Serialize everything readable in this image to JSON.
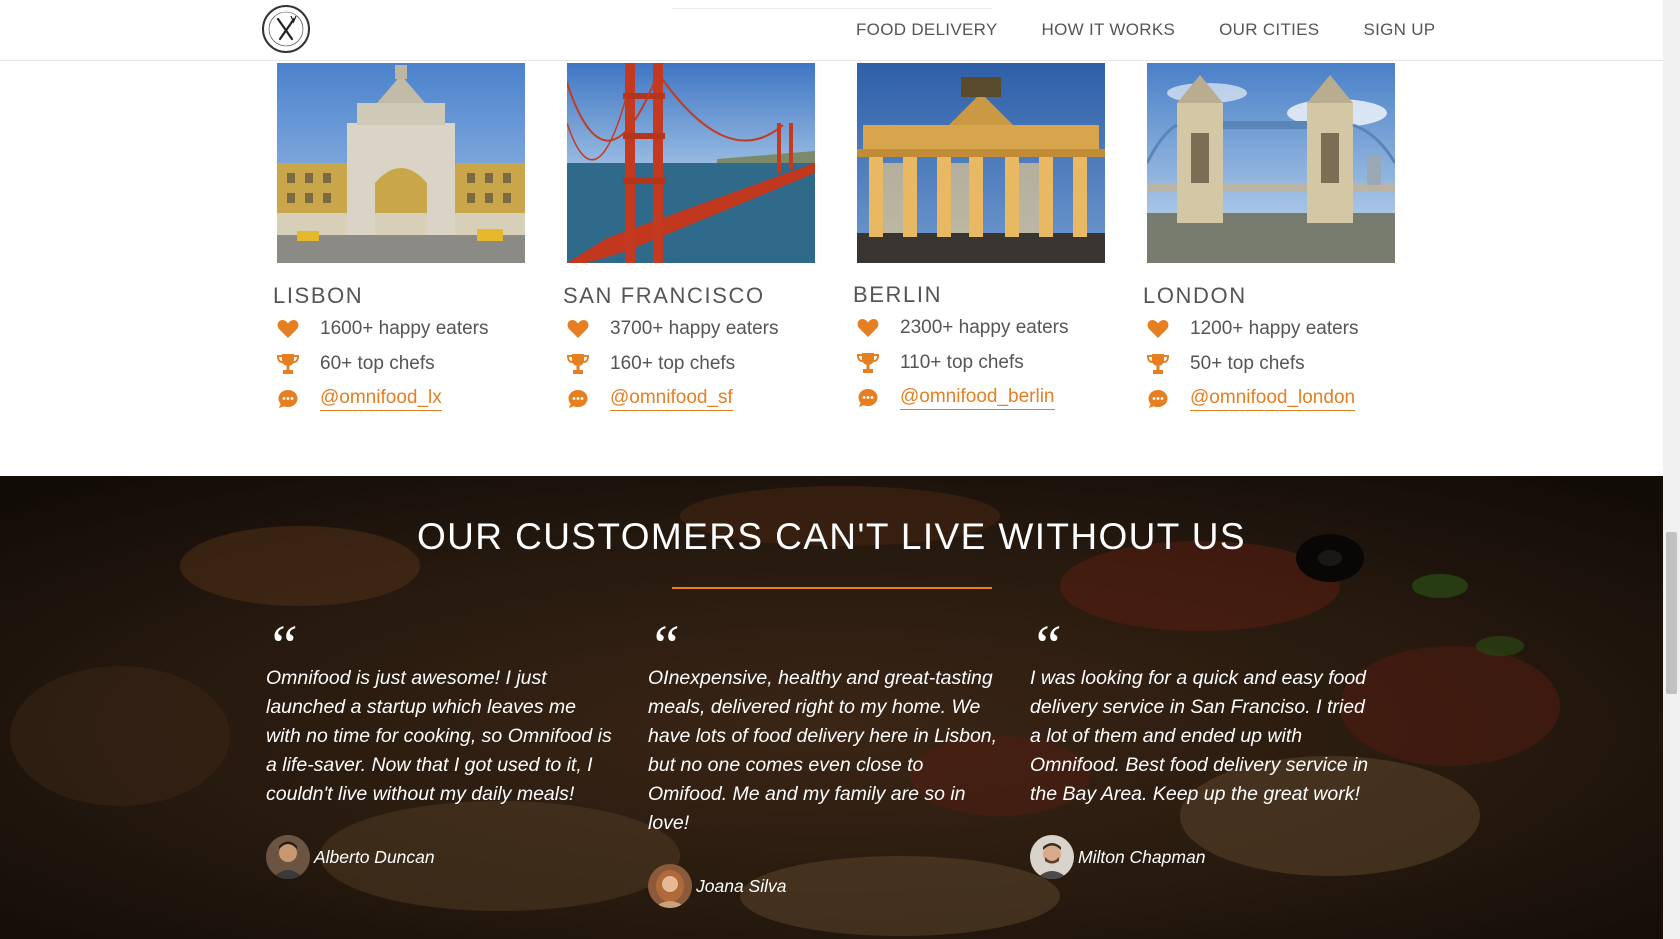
{
  "header": {
    "logo_alt": "Omnifood logo",
    "nav": [
      {
        "label": "FOOD DELIVERY"
      },
      {
        "label": "HOW IT WORKS"
      },
      {
        "label": "OUR CITIES"
      },
      {
        "label": "SIGN UP"
      }
    ]
  },
  "cities": [
    {
      "name": "LISBON",
      "eaters": "1600+ happy eaters",
      "chefs": "60+ top chefs",
      "handle": "@omnifood_lx",
      "image": "Lisbon Augusta Street Arch"
    },
    {
      "name": "SAN FRANCISCO",
      "eaters": "3700+ happy eaters",
      "chefs": "160+ top chefs",
      "handle": "@omnifood_sf",
      "image": "Golden Gate Bridge"
    },
    {
      "name": "BERLIN",
      "eaters": "2300+ happy eaters",
      "chefs": "110+ top chefs",
      "handle": "@omnifood_berlin",
      "image": "Brandenburg Gate"
    },
    {
      "name": "LONDON",
      "eaters": "1200+ happy eaters",
      "chefs": "50+ top chefs",
      "handle": "@omnifood_london",
      "image": "Tower Bridge"
    }
  ],
  "testimonials": {
    "title": "OUR CUSTOMERS CAN'T LIVE WITHOUT US",
    "quote_mark": "“",
    "items": [
      {
        "text": "Omnifood is just awesome! I just launched a startup which leaves me with no time for cooking, so Omnifood is a life-saver. Now that I got used to it, I couldn't live without my daily meals!",
        "author": "Alberto Duncan"
      },
      {
        "text": "OInexpensive, healthy and great-tasting meals, delivered right to my home. We have lots of food delivery here in Lisbon, but no one comes even close to Omifood. Me and my family are so in love!",
        "author": "Joana Silva"
      },
      {
        "text": "I was looking for a quick and easy food delivery service in San Franciso. I tried a lot of them and ended up with Omnifood. Best food delivery service in the Bay Area. Keep up the great work!",
        "author": "Milton Chapman"
      }
    ]
  },
  "colors": {
    "accent": "#e67e22",
    "text": "#555555"
  },
  "icons": [
    "heart-icon",
    "trophy-icon",
    "chat-icon",
    "fork-knife-icon"
  ]
}
